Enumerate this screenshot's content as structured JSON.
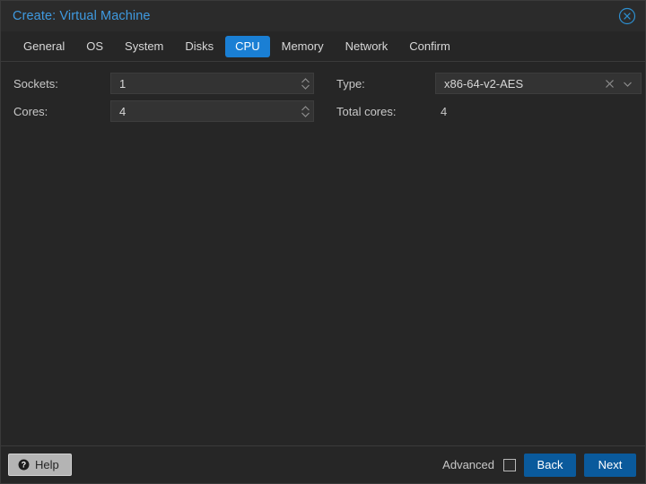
{
  "window": {
    "title": "Create: Virtual Machine",
    "close_icon": "close-circle-icon",
    "accent_color": "#1a7fd4",
    "title_color": "#3f9ae0",
    "background_color": "#262626"
  },
  "tabs": [
    {
      "label": "General",
      "active": false
    },
    {
      "label": "OS",
      "active": false
    },
    {
      "label": "System",
      "active": false
    },
    {
      "label": "Disks",
      "active": false
    },
    {
      "label": "CPU",
      "active": true
    },
    {
      "label": "Memory",
      "active": false
    },
    {
      "label": "Network",
      "active": false
    },
    {
      "label": "Confirm",
      "active": false
    }
  ],
  "form": {
    "sockets": {
      "label": "Sockets:",
      "value": "1",
      "stepper_icon": "spinner-updown-icon"
    },
    "cores": {
      "label": "Cores:",
      "value": "4",
      "stepper_icon": "spinner-updown-icon"
    },
    "type": {
      "label": "Type:",
      "value": "x86-64-v2-AES",
      "clear_icon": "clear-x-icon",
      "dropdown_icon": "chevron-down-icon"
    },
    "total_cores": {
      "label": "Total cores:",
      "value": "4"
    }
  },
  "footer": {
    "help_label": "Help",
    "help_icon": "question-circle-icon",
    "advanced_label": "Advanced",
    "advanced_checked": false,
    "back_label": "Back",
    "next_label": "Next",
    "button_color": "#0a5a9c"
  }
}
